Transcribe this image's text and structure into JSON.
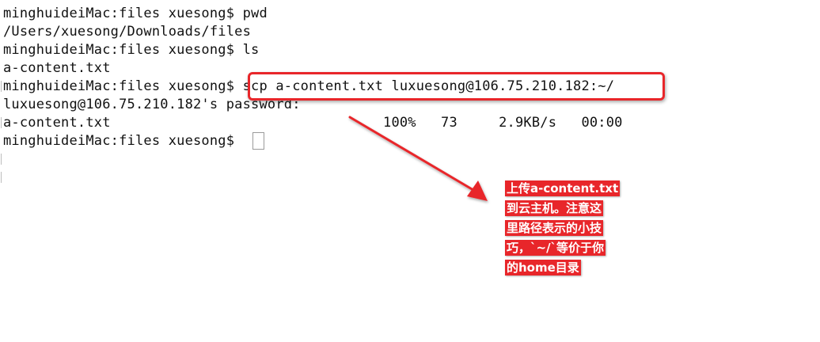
{
  "terminal": {
    "lines": [
      "minghuideiMac:files xuesong$ pwd",
      "/Users/xuesong/Downloads/files",
      "minghuideiMac:files xuesong$ ls",
      "a-content.txt",
      "minghuideiMac:files xuesong$ scp a-content.txt luxuesong@106.75.210.182:~/",
      "luxuesong@106.75.210.182's password:",
      "a-content.txt                                 100%   73     2.9KB/s   00:00",
      "minghuideiMac:files xuesong$ "
    ]
  },
  "annotation": {
    "color": "#e8262a",
    "lines": [
      "上传a-content.txt",
      "到云主机。注意这",
      "里路径表示的小技",
      "巧，`~/`等价于你",
      "的home目录"
    ]
  }
}
